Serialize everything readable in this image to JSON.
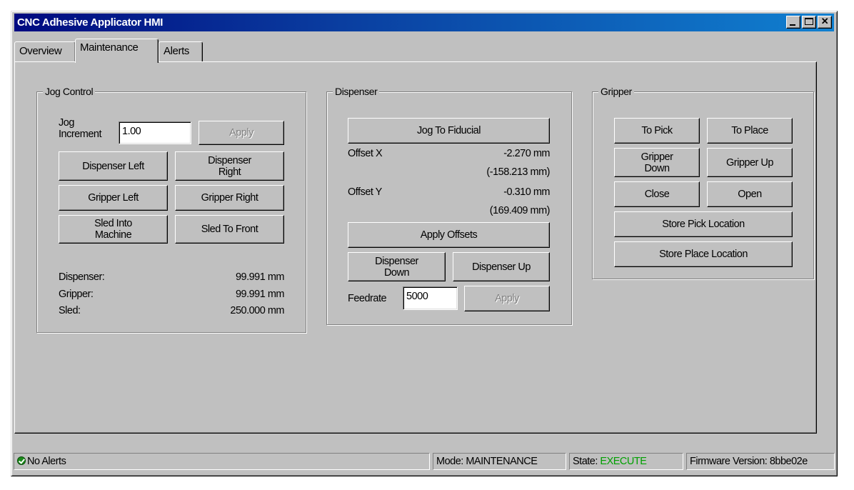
{
  "window": {
    "title": "CNC Adhesive Applicator HMI",
    "controls": {
      "minimize": "minimize",
      "maximize": "maximize",
      "close": "✕"
    }
  },
  "tabs": [
    {
      "label": "Overview",
      "active": false
    },
    {
      "label": "Maintenance",
      "active": true
    },
    {
      "label": "Alerts",
      "active": false
    }
  ],
  "jog_control": {
    "title": "Jog Control",
    "increment_label": "Jog\nIncrement",
    "increment_value": "1.00",
    "apply_label": "Apply",
    "buttons": {
      "dispenser_left": "Dispenser Left",
      "dispenser_right": "Dispenser\nRight",
      "gripper_left": "Gripper Left",
      "gripper_right": "Gripper Right",
      "sled_into_machine": "Sled Into\nMachine",
      "sled_to_front": "Sled To Front"
    },
    "positions": [
      {
        "label": "Dispenser:",
        "value": "99.991 mm"
      },
      {
        "label": "Gripper:",
        "value": "99.991 mm"
      },
      {
        "label": "Sled:",
        "value": "250.000 mm"
      }
    ]
  },
  "dispenser": {
    "title": "Dispenser",
    "jog_to_fiducial": "Jog To Fiducial",
    "offset_x_label": "Offset X",
    "offset_x_value": "-2.270 mm",
    "offset_x_abs": "(-158.213 mm)",
    "offset_y_label": "Offset Y",
    "offset_y_value": "-0.310 mm",
    "offset_y_abs": "(169.409 mm)",
    "apply_offsets": "Apply Offsets",
    "dispenser_down": "Dispenser\nDown",
    "dispenser_up": "Dispenser Up",
    "feedrate_label": "Feedrate",
    "feedrate_value": "5000",
    "apply_label": "Apply"
  },
  "gripper": {
    "title": "Gripper",
    "to_pick": "To Pick",
    "to_place": "To Place",
    "gripper_down": "Gripper\nDown",
    "gripper_up": "Gripper Up",
    "close": "Close",
    "open": "Open",
    "store_pick": "Store Pick Location",
    "store_place": "Store Place Location"
  },
  "statusbar": {
    "alerts_icon": "check-circle-icon",
    "alerts": "No Alerts",
    "mode": "Mode: MAINTENANCE",
    "state_label": "State: ",
    "state_value": "EXECUTE",
    "state_color": "#00a000",
    "firmware": "Firmware Version: 8bbe02e"
  }
}
